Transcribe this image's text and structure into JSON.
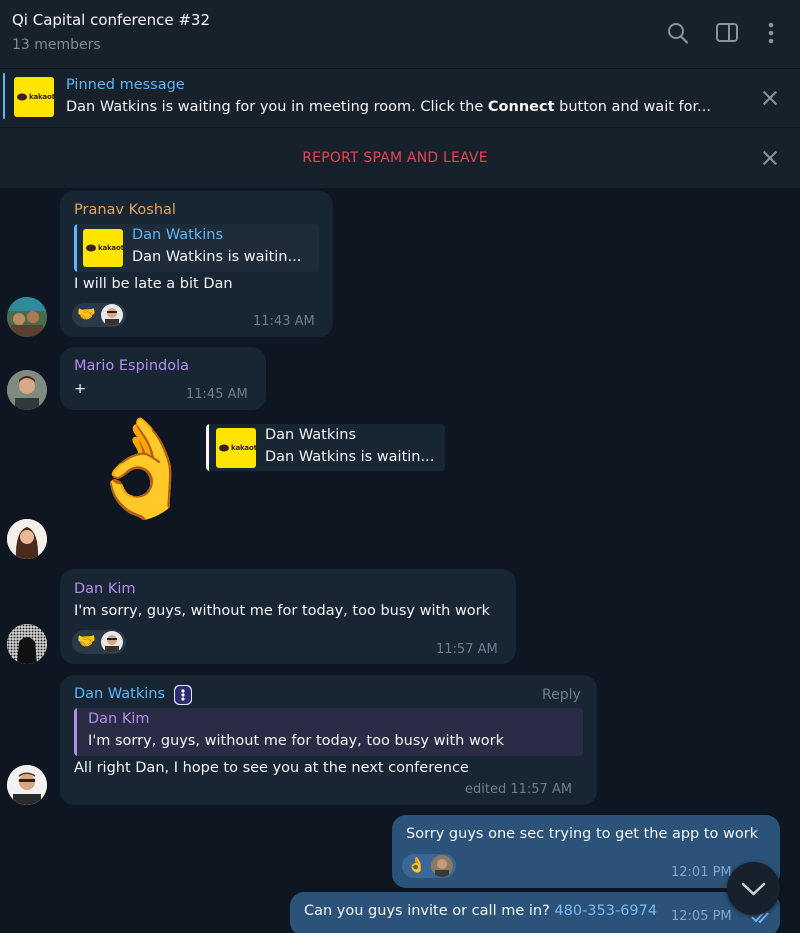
{
  "header": {
    "title": "Qi Capital conference #32",
    "subtitle": "13 members",
    "icons": [
      "search-icon",
      "sidebar-toggle-icon",
      "more-vertical-icon"
    ]
  },
  "pinned": {
    "label": "Pinned message",
    "text_before": "Dan Watkins is waiting for you in meeting room. Click the ",
    "text_bold": "Connect",
    "text_after": " button and wait for...",
    "thumb_text": "kakaotal"
  },
  "spam_bar": {
    "label": "REPORT SPAM AND LEAVE"
  },
  "messages": [
    {
      "sender": "Pranav Koshal",
      "quote_name": "Dan Watkins",
      "quote_text": "Dan Watkins is waitin...",
      "text": "I will be late a bit Dan",
      "reaction": "🤝",
      "time": "11:43 AM"
    },
    {
      "sender": "Mario Espindola",
      "text": "+",
      "time": "11:45 AM"
    },
    {
      "sticker": "👌",
      "quote_name": "Dan Watkins",
      "quote_text": "Dan Watkins is waitin..."
    },
    {
      "sender": "Dan Kim",
      "text": "I'm sorry, guys, without me for today, too busy with work",
      "reaction": "🤝",
      "time": "11:57 AM"
    },
    {
      "sender": "Dan Watkins",
      "reply_label": "Reply",
      "quote_name": "Dan Kim",
      "quote_text": "I'm sorry, guys, without me for today, too busy with work",
      "text": "All right Dan, I hope to see you at the next conference",
      "time": "edited 11:57 AM"
    },
    {
      "text": "Sorry guys one sec trying to get the app to work",
      "reaction": "👌",
      "time": "12:01 PM"
    },
    {
      "text": "Can you guys invite or call me in?",
      "link": "480-353-6974",
      "time": "12:05 PM"
    }
  ],
  "colors": {
    "background": "#0e1621",
    "panel": "#17212b",
    "incoming_bubble": "#182533",
    "outgoing_bubble": "#2b5278",
    "accent_blue": "#5eb5f7",
    "spam_red": "#e84552",
    "sender_orange": "#e6a35c",
    "sender_purple": "#b48cf0"
  }
}
